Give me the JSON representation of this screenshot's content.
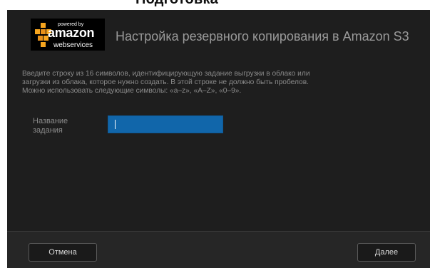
{
  "top_strip": {
    "text": "Подготовка"
  },
  "header": {
    "logo": {
      "powered_by": "powered by",
      "amazon": "amazon",
      "webservices": "webservices"
    },
    "title": "Настройка резервного копирования в Amazon S3"
  },
  "body": {
    "description_lines": [
      "Введите строку из 16 символов, идентифицирующую задание выгрузки в облако или",
      "загрузки из облака, которое нужно создать. В этой строке не должно быть пробелов.",
      "Можно использовать следующие символы: «a–z», «A–Z», «0–9»."
    ],
    "job_name_label": "Название задания",
    "job_name_value": ""
  },
  "footer": {
    "cancel_label": "Отмена",
    "next_label": "Далее"
  },
  "colors": {
    "dialog_bg": "#1e1e1e",
    "input_bg": "#1166aa",
    "title_text": "#9a9a9a"
  }
}
